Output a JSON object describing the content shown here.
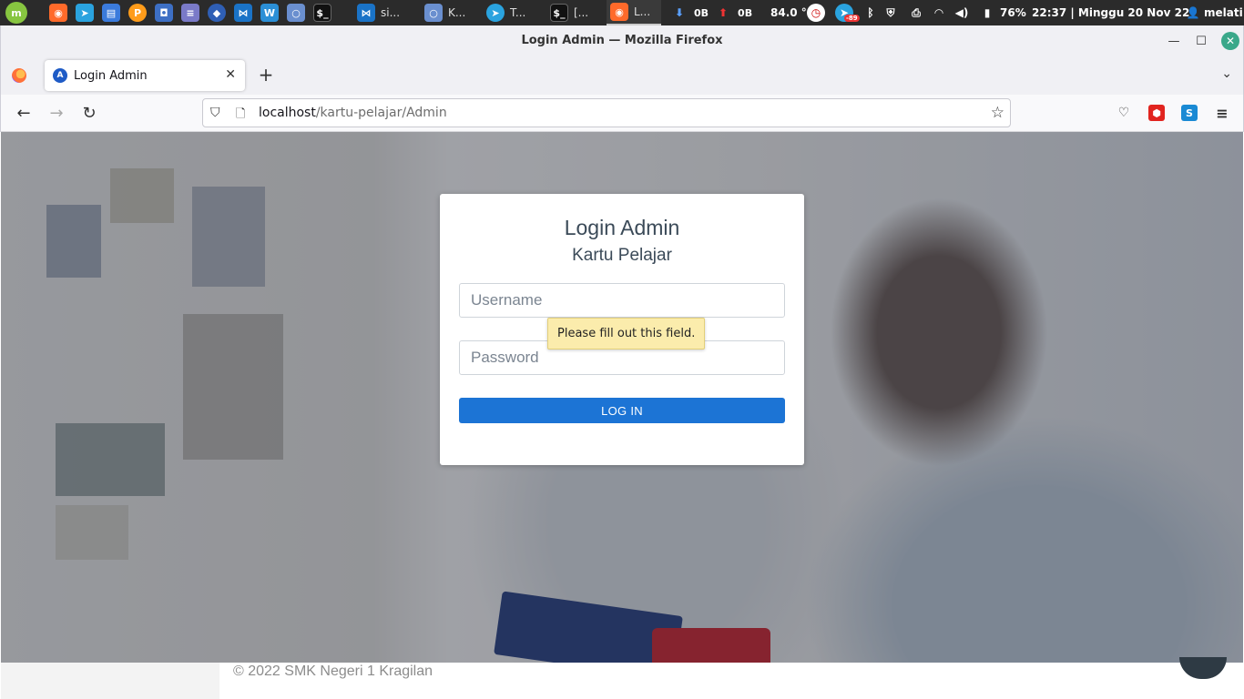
{
  "panel": {
    "tasks": [
      {
        "label": "si...",
        "icon": "vscode-icon"
      },
      {
        "label": "K...",
        "icon": "chromium-icon"
      },
      {
        "label": "T...",
        "icon": "telegram-icon"
      },
      {
        "label": "[...",
        "icon": "terminal-icon"
      },
      {
        "label": "L...",
        "icon": "firefox-icon"
      }
    ],
    "net_down": "0B",
    "net_up": "0B",
    "temperature": "84.0 °",
    "telegram_badge": "-89",
    "battery": "76%",
    "clock": "22:37 | Minggu 20 Nov 22",
    "user": "melati"
  },
  "window": {
    "title": "Login Admin — Mozilla Firefox"
  },
  "tab": {
    "label": "Login Admin"
  },
  "urlbar": {
    "host": "localhost",
    "path": "/kartu-pelajar/Admin"
  },
  "login": {
    "title": "Login Admin",
    "subtitle": "Kartu Pelajar",
    "username_placeholder": "Username",
    "password_placeholder": "Password",
    "button_label": "LOG IN",
    "validation_message": "Please fill out this field."
  },
  "footer": {
    "copyright": "© 2022 SMK Negeri 1 Kragilan"
  },
  "colors": {
    "primary_button": "#1c74d5",
    "tooltip_bg": "#fbecac",
    "panel_bg": "#2b2b2b"
  }
}
